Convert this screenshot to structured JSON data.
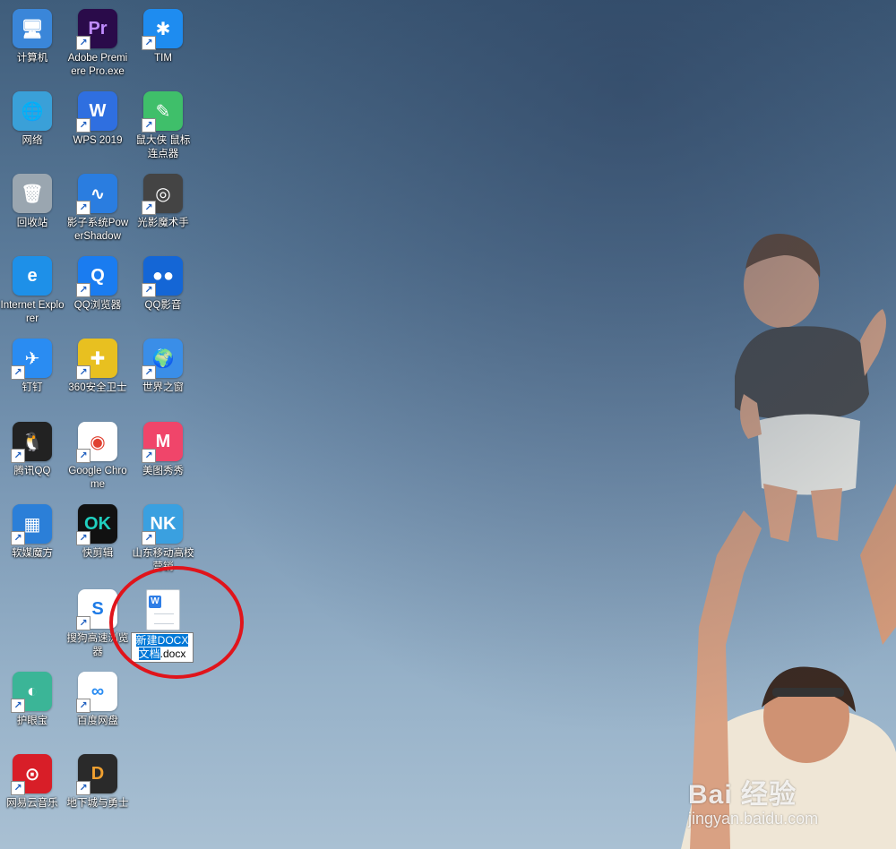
{
  "icons": [
    {
      "label": "计算机",
      "color": "#3a86d9",
      "glyph": "🖥",
      "shortcut": false
    },
    {
      "label": "Adobe Premiere Pro.exe",
      "color": "#2a0b4a",
      "glyph": "Pr",
      "fg": "#c08cff",
      "shortcut": true
    },
    {
      "label": "TIM",
      "color": "#1e8cf0",
      "glyph": "✱",
      "shortcut": true
    },
    {
      "label": "网络",
      "color": "#3aa0d8",
      "glyph": "🌐",
      "shortcut": false
    },
    {
      "label": "WPS 2019",
      "color": "#2f6fe0",
      "glyph": "W",
      "shortcut": true
    },
    {
      "label": "鼠大侠 鼠标连点器",
      "color": "#3fbf6a",
      "glyph": "✎",
      "shortcut": true
    },
    {
      "label": "回收站",
      "color": "#9aa6b0",
      "glyph": "🗑",
      "shortcut": false
    },
    {
      "label": "影子系统PowerShadow",
      "color": "#2a7de0",
      "glyph": "∿",
      "shortcut": true
    },
    {
      "label": "光影魔术手",
      "color": "#444",
      "glyph": "◎",
      "shortcut": true
    },
    {
      "label": "Internet Explorer",
      "color": "#1e90e8",
      "glyph": "e",
      "shortcut": false
    },
    {
      "label": "QQ浏览器",
      "color": "#1a7cf0",
      "glyph": "Q",
      "shortcut": true
    },
    {
      "label": "QQ影音",
      "color": "#1466d6",
      "glyph": "●●",
      "shortcut": true
    },
    {
      "label": "钉钉",
      "color": "#2a8cf2",
      "glyph": "✈",
      "shortcut": true
    },
    {
      "label": "360安全卫士",
      "color": "#e8c020",
      "glyph": "✚",
      "shortcut": true
    },
    {
      "label": "世界之窗",
      "color": "#3a8ee8",
      "glyph": "🌍",
      "shortcut": true
    },
    {
      "label": "腾讯QQ",
      "color": "#222",
      "glyph": "🐧",
      "shortcut": true
    },
    {
      "label": "Google Chrome",
      "color": "#ffffff",
      "glyph": "◉",
      "fg": "#e04030",
      "shortcut": true
    },
    {
      "label": "美图秀秀",
      "color": "#f0456a",
      "glyph": "M",
      "shortcut": true
    },
    {
      "label": "软媒魔方",
      "color": "#2b7fd8",
      "glyph": "▦",
      "shortcut": true
    },
    {
      "label": "快剪辑",
      "color": "#111",
      "glyph": "OK",
      "fg": "#20d0c0",
      "shortcut": true
    },
    {
      "label": "山东移动高校营销",
      "color": "#3aa0e0",
      "glyph": "NK",
      "shortcut": true
    },
    {
      "label": "",
      "color": "transparent",
      "glyph": "",
      "shortcut": false
    },
    {
      "label": "搜狗高速浏览器",
      "color": "#ffffff",
      "glyph": "S",
      "fg": "#1e7be6",
      "shortcut": true
    },
    {
      "label": "",
      "color": "transparent",
      "glyph": "",
      "shortcut": false
    },
    {
      "label": "护眼宝",
      "color": "#3bb597",
      "glyph": "◐",
      "shortcut": true
    },
    {
      "label": "百度网盘",
      "color": "#ffffff",
      "glyph": "∞",
      "fg": "#2a8cf2",
      "shortcut": true
    },
    {
      "label": "",
      "color": "transparent",
      "glyph": "",
      "shortcut": false
    },
    {
      "label": "网易云音乐",
      "color": "#d81e28",
      "glyph": "⊙",
      "shortcut": true
    },
    {
      "label": "地下城与勇士",
      "color": "#2a2a2a",
      "glyph": "D",
      "fg": "#f0a030",
      "shortcut": true
    }
  ],
  "new_doc": {
    "rename_selected": "新建DOCX文档",
    "rename_ext": ".docx",
    "badge": "W"
  },
  "watermark": {
    "logo": "Bai 经验",
    "url": "jingyan.baidu.com"
  }
}
